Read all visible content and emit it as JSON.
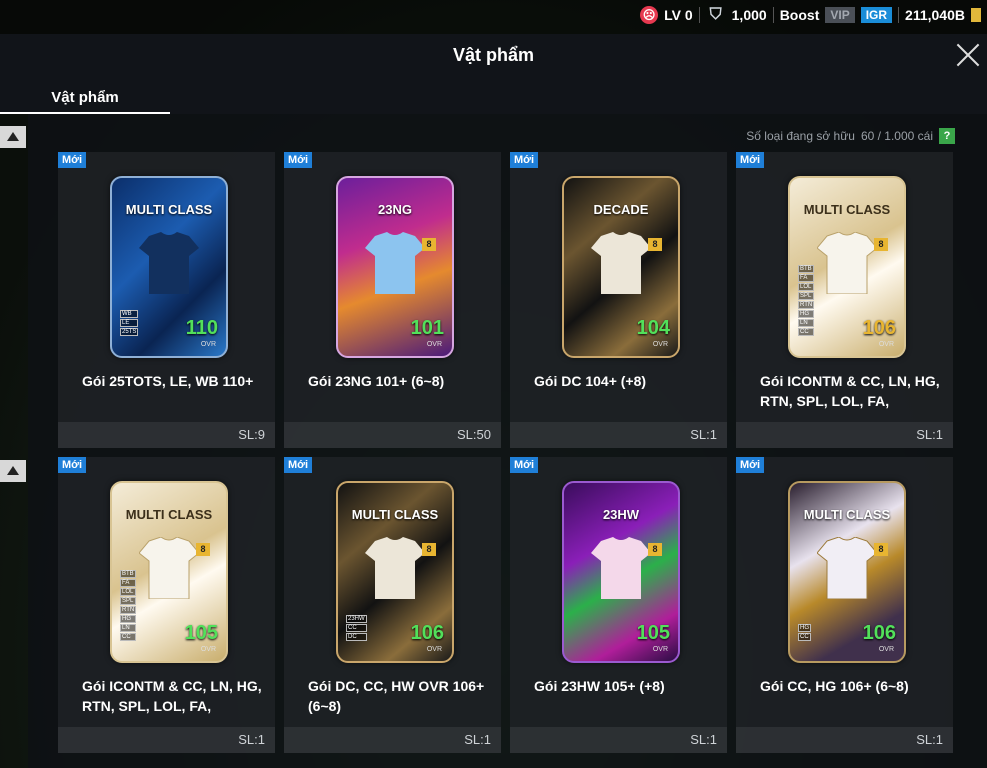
{
  "topbar": {
    "level": "LV 0",
    "coins": "1,000",
    "boost": "Boost",
    "vip": "VIP",
    "igr": "IGR",
    "balance": "211,040B"
  },
  "header": {
    "title": "Vật phẩm"
  },
  "tabs": [
    {
      "label": "Vật phẩm"
    }
  ],
  "ownership": {
    "label": "Số loại đang sở hữu",
    "value": "60 / 1.000 cái",
    "help": "?"
  },
  "items": [
    {
      "new": "Mới",
      "card_title": "MULTI CLASS",
      "ovr": "110",
      "name": "Gói 25TOTS, LE, WB 110+",
      "qty": "SL:9"
    },
    {
      "new": "Mới",
      "card_title": "23NG",
      "ovr": "101",
      "name": "Gói 23NG 101+ (6~8)",
      "qty": "SL:50"
    },
    {
      "new": "Mới",
      "card_title": "DECADE",
      "ovr": "104",
      "name": "Gói DC 104+ (+8)",
      "qty": "SL:1"
    },
    {
      "new": "Mới",
      "card_title": "MULTI CLASS",
      "ovr": "106",
      "name": "Gói ICONTM & CC, LN, HG, RTN, SPL, LOL, FA,",
      "qty": "SL:1"
    },
    {
      "new": "Mới",
      "card_title": "MULTI CLASS",
      "ovr": "105",
      "name": "Gói ICONTM & CC, LN, HG, RTN, SPL, LOL, FA,",
      "qty": "SL:1"
    },
    {
      "new": "Mới",
      "card_title": "MULTI CLASS",
      "ovr": "106",
      "name": "Gói DC, CC, HW OVR 106+ (6~8)",
      "qty": "SL:1"
    },
    {
      "new": "Mới",
      "card_title": "23HW",
      "ovr": "105",
      "name": "Gói 23HW 105+ (+8)",
      "qty": "SL:1"
    },
    {
      "new": "Mới",
      "card_title": "MULTI CLASS",
      "ovr": "106",
      "name": "Gói CC, HG 106+ (6~8)",
      "qty": "SL:1"
    }
  ]
}
